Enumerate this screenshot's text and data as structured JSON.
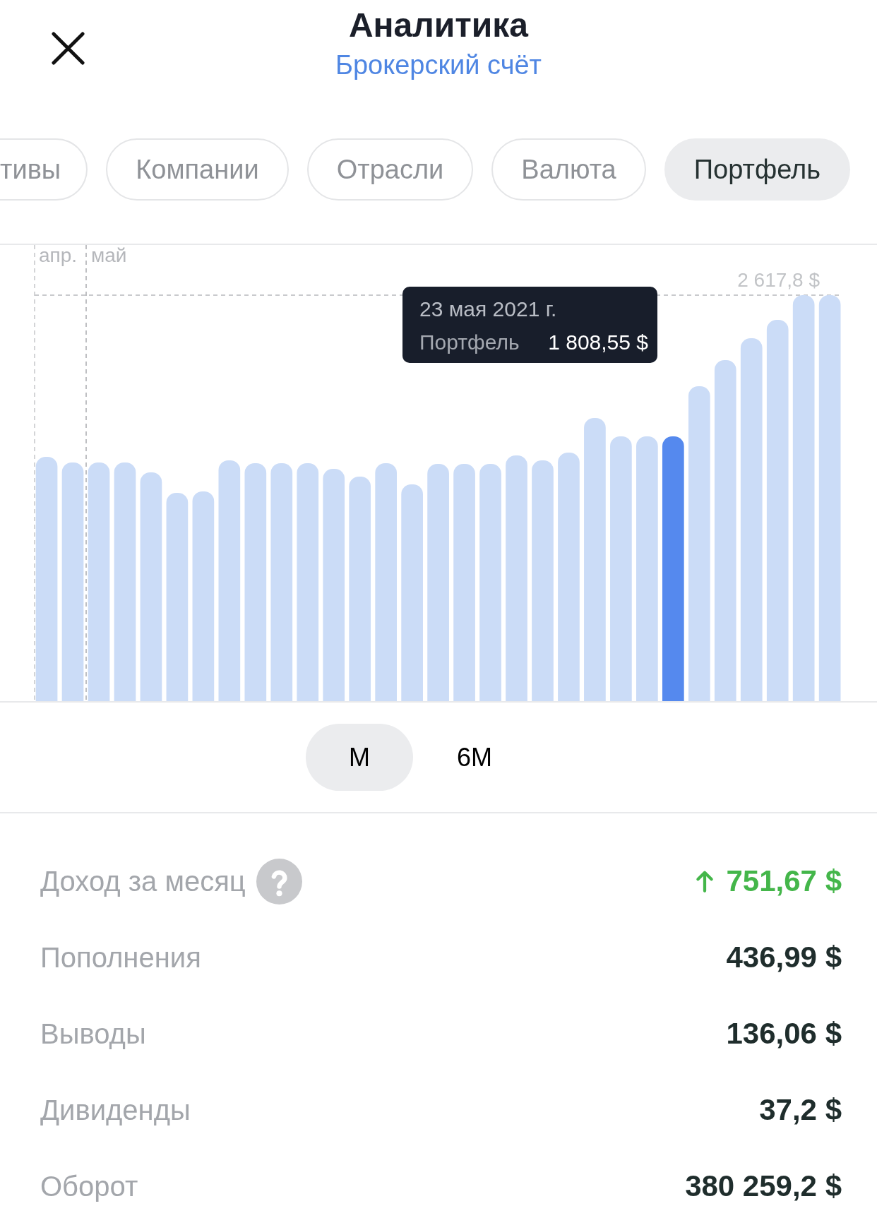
{
  "header": {
    "title": "Аналитика",
    "subtitle": "Брокерский счёт"
  },
  "tabs": [
    {
      "label": "тивы",
      "selected": false,
      "clipped": true
    },
    {
      "label": "Компании",
      "selected": false,
      "clipped": false
    },
    {
      "label": "Отрасли",
      "selected": false,
      "clipped": false
    },
    {
      "label": "Валюта",
      "selected": false,
      "clipped": false
    },
    {
      "label": "Портфель",
      "selected": true,
      "clipped": false
    }
  ],
  "chart": {
    "month_labels": [
      "апр.",
      "май"
    ],
    "max_label": "2 617,8 $",
    "tooltip": {
      "date": "23 мая 2021 г.",
      "series": "Портфель",
      "value": "1 808,55 $"
    },
    "bars": [
      {
        "selected": false
      },
      {
        "selected": false
      },
      {
        "selected": false
      },
      {
        "selected": false
      },
      {
        "selected": false
      },
      {
        "selected": false
      },
      {
        "selected": false
      },
      {
        "selected": false
      },
      {
        "selected": false
      },
      {
        "selected": false
      },
      {
        "selected": false
      },
      {
        "selected": false
      },
      {
        "selected": false
      },
      {
        "selected": false
      },
      {
        "selected": false
      },
      {
        "selected": false
      },
      {
        "selected": false
      },
      {
        "selected": false
      },
      {
        "selected": false
      },
      {
        "selected": false
      },
      {
        "selected": false
      },
      {
        "selected": false
      },
      {
        "selected": false
      },
      {
        "selected": false
      },
      {
        "selected": true
      },
      {
        "selected": false
      },
      {
        "selected": false
      },
      {
        "selected": false
      },
      {
        "selected": false
      },
      {
        "selected": false
      },
      {
        "selected": false
      }
    ]
  },
  "periods": [
    {
      "label": "М",
      "selected": true
    },
    {
      "label": "6М",
      "selected": false
    }
  ],
  "stats": [
    {
      "label": "Доход за месяц",
      "value": "751,67 $",
      "kind": "gain",
      "help": true
    },
    {
      "label": "Пополнения",
      "value": "436,99 $",
      "kind": "amount",
      "help": false
    },
    {
      "label": "Выводы",
      "value": "136,06 $",
      "kind": "amount",
      "help": false
    },
    {
      "label": "Дивиденды",
      "value": "37,2 $",
      "kind": "amount",
      "help": false
    },
    {
      "label": "Оборот",
      "value": "380 259,2 $",
      "kind": "amount",
      "help": false
    }
  ]
}
